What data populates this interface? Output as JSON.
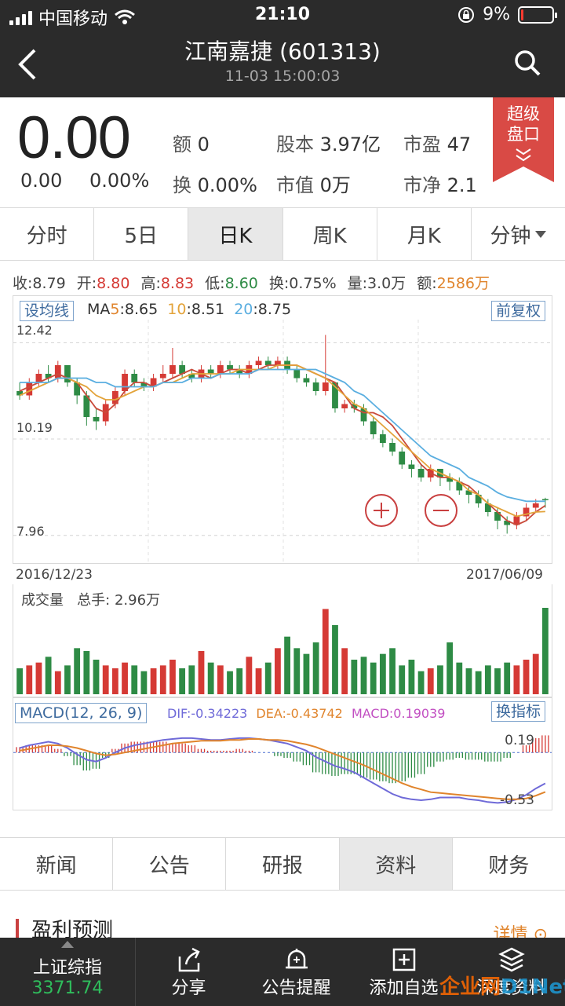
{
  "status_bar": {
    "carrier": "中国移动",
    "time": "21:10",
    "battery": "9%",
    "battery_level": 0.09
  },
  "nav": {
    "title": "江南嘉捷 (601313)",
    "subtitle": "11-03 15:00:03"
  },
  "quote": {
    "price": "0.00",
    "change": "0.00",
    "change_pct": "0.00%",
    "amount_label": "额",
    "amount_value": "0",
    "turnover_label": "换",
    "turnover_value": "0.00%",
    "share_capital_label": "股本",
    "share_capital_value": "3.97亿",
    "market_value_label": "市值",
    "market_value_value": "0万",
    "pe_label": "市盈",
    "pe_value": "47",
    "pb_label": "市净",
    "pb_value": "2.1"
  },
  "super_panel": {
    "line1": "超级",
    "line2": "盘口"
  },
  "period_tabs": [
    {
      "label": "分时",
      "active": false
    },
    {
      "label": "5日",
      "active": false
    },
    {
      "label": "日K",
      "active": true
    },
    {
      "label": "周K",
      "active": false
    },
    {
      "label": "月K",
      "active": false
    },
    {
      "label": "分钟",
      "active": false,
      "dropdown": true
    }
  ],
  "ohlc": {
    "close_label": "收:",
    "close": "8.79",
    "open_label": "开:",
    "open": "8.80",
    "high_label": "高:",
    "high": "8.83",
    "low_label": "低:",
    "low": "8.60",
    "turnover_label": "换:",
    "turnover": "0.75%",
    "volume_label": "量:",
    "volume": "3.0万",
    "amount_label": "额:",
    "amount": "2586万"
  },
  "kline": {
    "set_ma_label": "设均线",
    "ma_prefix": "MA",
    "ma5_label": "5",
    "ma5_value": ":8.65",
    "ma10_label": "10",
    "ma10_value": ":8.51",
    "ma20_label": "20",
    "ma20_value": ":8.75",
    "adjust_label": "前复权",
    "y_high": "12.42",
    "y_mid": "10.19",
    "y_low": "7.96",
    "date_start": "2016/12/23",
    "date_end": "2017/06/09"
  },
  "volume_panel": {
    "title": "成交量",
    "total_label": "总手:",
    "total_value": "2.96万"
  },
  "macd_panel": {
    "label": "MACD(12, 26, 9)",
    "dif_label": "DIF:",
    "dif": "-0.34223",
    "dea_label": "DEA:",
    "dea": "-0.43742",
    "macd_label": "MACD:",
    "macd": "0.19039",
    "switch_label": "换指标",
    "y_top": "0.19",
    "y_bottom": "-0.53"
  },
  "info_tabs": [
    {
      "label": "新闻",
      "active": false
    },
    {
      "label": "公告",
      "active": false
    },
    {
      "label": "研报",
      "active": false
    },
    {
      "label": "资料",
      "active": true
    },
    {
      "label": "财务",
      "active": false
    }
  ],
  "section": {
    "title": "盈利预测",
    "detail": "详情"
  },
  "bottom_bar": {
    "index_name": "上证综指",
    "index_value": "3371.74",
    "items": [
      {
        "label": "分享",
        "icon": "share-icon"
      },
      {
        "label": "公告提醒",
        "icon": "bell-icon"
      },
      {
        "label": "添加自选",
        "icon": "add-icon"
      },
      {
        "label": "深度资料",
        "icon": "layers-icon"
      }
    ]
  },
  "watermark": {
    "part1": "企业网",
    "part2": "D1Net"
  },
  "colors": {
    "up": "#d53a35",
    "down": "#2e8b45",
    "ma5": "#c94a3a",
    "ma10": "#e3a33a",
    "ma20": "#5aaee0",
    "dif": "#6f6ad8",
    "dea": "#e0842c"
  },
  "chart_data": {
    "type": "candlestick",
    "x_range": [
      "2016/12/23",
      "2017/06/09"
    ],
    "ylim": [
      7.96,
      12.42
    ],
    "y_ticks": [
      12.42,
      10.19,
      7.96
    ],
    "series": [
      {
        "name": "MA5",
        "values": [
          11.3,
          11.4,
          11.5,
          11.6,
          11.7,
          11.6,
          11.5,
          11.2,
          10.9,
          10.8,
          11.0,
          11.3,
          11.5,
          11.5,
          11.4,
          11.5,
          11.6,
          11.7,
          11.8,
          11.7,
          11.6,
          11.7,
          11.8,
          11.8,
          11.7,
          11.8,
          11.9,
          11.9,
          11.9,
          11.9,
          11.8,
          11.7,
          11.6,
          11.5,
          11.2,
          10.9,
          10.8,
          10.8,
          10.7,
          10.5,
          10.2,
          9.9,
          9.6,
          9.4,
          9.3,
          9.3,
          9.2,
          9.1,
          8.9,
          8.7,
          8.5,
          8.3,
          8.2,
          8.3,
          8.5,
          8.65
        ]
      },
      {
        "name": "10",
        "values": [
          11.2,
          11.3,
          11.4,
          11.5,
          11.6,
          11.6,
          11.5,
          11.4,
          11.2,
          11.1,
          11.1,
          11.2,
          11.3,
          11.4,
          11.4,
          11.5,
          11.5,
          11.6,
          11.7,
          11.7,
          11.7,
          11.7,
          11.7,
          11.8,
          11.8,
          11.8,
          11.8,
          11.9,
          11.9,
          11.9,
          11.8,
          11.7,
          11.6,
          11.4,
          11.2,
          11.0,
          10.9,
          10.7,
          10.5,
          10.3,
          10.1,
          9.9,
          9.7,
          9.5,
          9.4,
          9.3,
          9.2,
          9.0,
          8.9,
          8.7,
          8.6,
          8.5,
          8.4,
          8.45,
          8.5,
          8.51
        ]
      },
      {
        "name": "20",
        "values": [
          11.5,
          11.5,
          11.5,
          11.5,
          11.6,
          11.6,
          11.6,
          11.6,
          11.5,
          11.5,
          11.4,
          11.4,
          11.4,
          11.4,
          11.4,
          11.5,
          11.5,
          11.5,
          11.6,
          11.6,
          11.6,
          11.7,
          11.7,
          11.7,
          11.7,
          11.8,
          11.8,
          11.8,
          11.8,
          11.8,
          11.8,
          11.8,
          11.7,
          11.6,
          11.5,
          11.3,
          11.2,
          11.0,
          10.8,
          10.6,
          10.4,
          10.2,
          10.0,
          9.8,
          9.7,
          9.6,
          9.5,
          9.3,
          9.2,
          9.1,
          8.95,
          8.85,
          8.8,
          8.75,
          8.75,
          8.75
        ]
      }
    ],
    "candles": [
      [
        11.3,
        11.2,
        11.5,
        11.1
      ],
      [
        11.2,
        11.5,
        11.6,
        11.1
      ],
      [
        11.5,
        11.7,
        11.8,
        11.4
      ],
      [
        11.7,
        11.6,
        11.9,
        11.5
      ],
      [
        11.6,
        11.9,
        12.0,
        11.5
      ],
      [
        11.9,
        11.5,
        11.9,
        11.4
      ],
      [
        11.5,
        11.2,
        11.6,
        11.0
      ],
      [
        11.2,
        10.7,
        11.3,
        10.5
      ],
      [
        10.7,
        10.6,
        10.9,
        10.4
      ],
      [
        10.6,
        11.0,
        11.1,
        10.5
      ],
      [
        11.0,
        11.3,
        11.4,
        10.9
      ],
      [
        11.3,
        11.7,
        11.8,
        11.2
      ],
      [
        11.7,
        11.5,
        11.8,
        11.4
      ],
      [
        11.5,
        11.4,
        11.6,
        11.3
      ],
      [
        11.4,
        11.6,
        11.7,
        11.3
      ],
      [
        11.6,
        11.7,
        11.9,
        11.5
      ],
      [
        11.7,
        11.9,
        12.3,
        11.6
      ],
      [
        11.9,
        11.7,
        12.0,
        11.6
      ],
      [
        11.7,
        11.6,
        11.8,
        11.5
      ],
      [
        11.6,
        11.8,
        11.9,
        11.5
      ],
      [
        11.8,
        11.7,
        11.9,
        11.6
      ],
      [
        11.7,
        11.9,
        12.0,
        11.6
      ],
      [
        11.9,
        11.8,
        12.0,
        11.7
      ],
      [
        11.8,
        11.7,
        11.9,
        11.6
      ],
      [
        11.7,
        11.9,
        12.0,
        11.6
      ],
      [
        11.9,
        12.0,
        12.1,
        11.8
      ],
      [
        12.0,
        11.9,
        12.1,
        11.8
      ],
      [
        11.9,
        12.0,
        12.1,
        11.8
      ],
      [
        12.0,
        11.8,
        12.1,
        11.7
      ],
      [
        11.8,
        11.6,
        11.9,
        11.5
      ],
      [
        11.6,
        11.5,
        11.7,
        11.4
      ],
      [
        11.5,
        11.3,
        11.6,
        11.2
      ],
      [
        11.3,
        11.5,
        12.6,
        11.2
      ],
      [
        11.5,
        10.9,
        11.5,
        10.8
      ],
      [
        10.9,
        11.0,
        11.1,
        10.8
      ],
      [
        11.0,
        10.9,
        11.1,
        10.8
      ],
      [
        10.9,
        10.6,
        11.0,
        10.5
      ],
      [
        10.6,
        10.3,
        10.7,
        10.2
      ],
      [
        10.3,
        10.1,
        10.4,
        10.0
      ],
      [
        10.1,
        9.9,
        10.2,
        9.8
      ],
      [
        9.9,
        9.6,
        10.0,
        9.5
      ],
      [
        9.6,
        9.5,
        9.7,
        9.3
      ],
      [
        9.5,
        9.3,
        9.6,
        9.2
      ],
      [
        9.3,
        9.5,
        9.6,
        9.2
      ],
      [
        9.5,
        9.3,
        9.5,
        9.1
      ],
      [
        9.3,
        9.2,
        9.4,
        9.0
      ],
      [
        9.2,
        9.0,
        9.3,
        8.9
      ],
      [
        9.0,
        8.9,
        9.1,
        8.7
      ],
      [
        8.9,
        8.7,
        9.0,
        8.6
      ],
      [
        8.7,
        8.5,
        8.8,
        8.4
      ],
      [
        8.5,
        8.3,
        8.6,
        8.1
      ],
      [
        8.3,
        8.2,
        8.4,
        8.0
      ],
      [
        8.2,
        8.4,
        8.5,
        8.1
      ],
      [
        8.4,
        8.6,
        8.7,
        8.3
      ],
      [
        8.6,
        8.7,
        8.8,
        8.5
      ],
      [
        8.8,
        8.79,
        8.83,
        8.6
      ]
    ],
    "volume": [
      0.9,
      1.0,
      1.1,
      1.3,
      0.8,
      1.0,
      1.6,
      1.5,
      1.2,
      1.0,
      0.9,
      1.1,
      1.0,
      0.8,
      0.9,
      1.0,
      1.2,
      0.9,
      1.0,
      1.5,
      1.1,
      1.0,
      0.8,
      0.9,
      1.3,
      0.9,
      1.1,
      1.6,
      2.0,
      1.6,
      1.4,
      1.8,
      2.96,
      2.4,
      1.6,
      1.2,
      1.3,
      1.1,
      1.4,
      1.6,
      1.0,
      1.2,
      0.8,
      0.9,
      1.0,
      1.8,
      1.1,
      0.9,
      0.8,
      1.0,
      0.9,
      1.1,
      1.0,
      1.2,
      1.4,
      3.0
    ],
    "macd": {
      "dif": [
        0.05,
        0.08,
        0.1,
        0.12,
        0.1,
        0.05,
        -0.02,
        -0.08,
        -0.1,
        -0.06,
        0.0,
        0.05,
        0.08,
        0.1,
        0.12,
        0.14,
        0.15,
        0.16,
        0.16,
        0.15,
        0.14,
        0.14,
        0.15,
        0.16,
        0.16,
        0.15,
        0.14,
        0.12,
        0.1,
        0.06,
        0.02,
        -0.05,
        -0.1,
        -0.15,
        -0.18,
        -0.22,
        -0.28,
        -0.34,
        -0.4,
        -0.46,
        -0.5,
        -0.52,
        -0.53,
        -0.52,
        -0.5,
        -0.5,
        -0.5,
        -0.52,
        -0.53,
        -0.55,
        -0.56,
        -0.55,
        -0.52,
        -0.47,
        -0.4,
        -0.34223
      ],
      "dea": [
        0.02,
        0.04,
        0.06,
        0.08,
        0.08,
        0.07,
        0.05,
        0.02,
        -0.01,
        -0.03,
        -0.02,
        0.0,
        0.02,
        0.04,
        0.06,
        0.08,
        0.1,
        0.11,
        0.12,
        0.13,
        0.13,
        0.13,
        0.14,
        0.14,
        0.15,
        0.15,
        0.14,
        0.14,
        0.13,
        0.11,
        0.09,
        0.06,
        0.02,
        -0.02,
        -0.06,
        -0.1,
        -0.14,
        -0.19,
        -0.24,
        -0.29,
        -0.34,
        -0.38,
        -0.41,
        -0.44,
        -0.45,
        -0.46,
        -0.47,
        -0.48,
        -0.49,
        -0.5,
        -0.51,
        -0.52,
        -0.52,
        -0.51,
        -0.48,
        -0.43742
      ],
      "hist": [
        0.06,
        0.08,
        0.08,
        0.08,
        0.04,
        -0.04,
        -0.14,
        -0.2,
        -0.18,
        -0.06,
        0.04,
        0.1,
        0.12,
        0.12,
        0.12,
        0.12,
        0.1,
        0.1,
        0.08,
        0.04,
        0.02,
        0.02,
        0.02,
        0.04,
        0.02,
        0.0,
        0.0,
        -0.04,
        -0.06,
        -0.1,
        -0.14,
        -0.22,
        -0.24,
        -0.26,
        -0.24,
        -0.24,
        -0.28,
        -0.3,
        -0.32,
        -0.34,
        -0.32,
        -0.28,
        -0.24,
        -0.16,
        -0.1,
        -0.08,
        -0.06,
        -0.08,
        -0.08,
        -0.1,
        -0.1,
        -0.06,
        0.0,
        0.08,
        0.16,
        0.19039
      ]
    }
  }
}
